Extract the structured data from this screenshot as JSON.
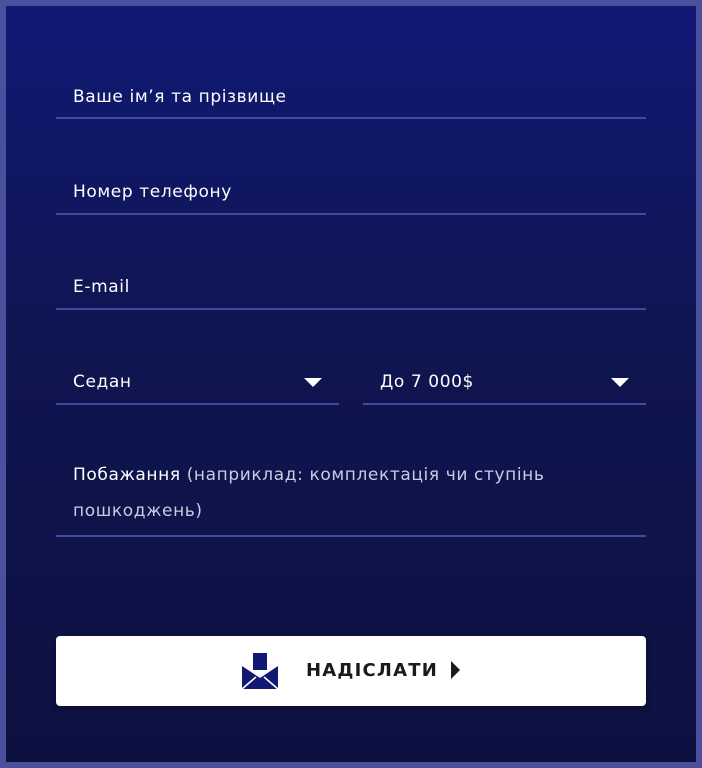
{
  "form": {
    "name_placeholder": "Ваше ім’я та прізвище",
    "phone_placeholder": "Номер телефону",
    "email_placeholder": "E-mail",
    "car_type": {
      "selected": "Седан"
    },
    "budget": {
      "selected": "До 7 000$"
    },
    "wishes": {
      "label": "Побажання",
      "hint": "(наприклад: комплектація чи ступінь пошкоджень)"
    },
    "submit_label": "НАДІСЛАТИ"
  },
  "icons": {
    "submit_icon": "envelope-icon",
    "submit_arrow": "play-arrow-icon",
    "select_caret": "caret-down-icon"
  },
  "colors": {
    "background_top": "#111975",
    "background_bottom": "#0d1140",
    "frame": "#4a4f9e",
    "underline": "#3f4aa3",
    "button_bg": "#ffffff",
    "icon_navy": "#111975"
  }
}
